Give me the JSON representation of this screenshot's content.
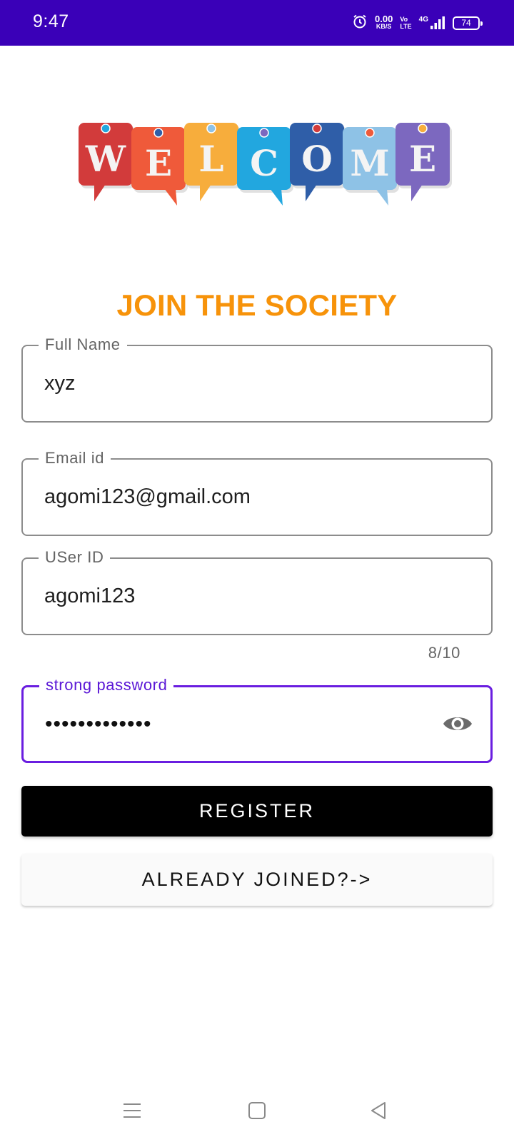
{
  "status_bar": {
    "time": "9:47",
    "net_speed_value": "0.00",
    "net_speed_unit": "KB/S",
    "volte_top": "Vo",
    "volte_bottom": "LTE",
    "network": "4G",
    "battery": "74"
  },
  "banner": {
    "letters": [
      "W",
      "E",
      "L",
      "C",
      "O",
      "M",
      "E"
    ],
    "colors": [
      "#d23b3b",
      "#ef5a3a",
      "#f7ad3c",
      "#22a7df",
      "#2f5ea8",
      "#8ec2e6",
      "#7c68bf"
    ]
  },
  "title": "JOIN THE SOCIETY",
  "fields": {
    "full_name": {
      "label": "Full Name",
      "value": "xyz"
    },
    "email": {
      "label": "Email id",
      "value": "agomi123@gmail.com"
    },
    "user_id": {
      "label": "USer ID",
      "value": "agomi123",
      "counter": "8/10"
    },
    "password": {
      "label": "strong password",
      "value": "•••••••••••••"
    }
  },
  "buttons": {
    "register": "REGISTER",
    "already_joined": "ALREADY JOINED?->"
  },
  "colors": {
    "status_bar": "#3a00b8",
    "title": "#f7930a",
    "focus": "#6a1ee0",
    "register_bg": "#000000"
  },
  "icons": {
    "status": [
      "alarm-icon",
      "volte-icon",
      "signal-icon",
      "battery-icon"
    ],
    "password_toggle": "eye-icon",
    "nav": [
      "menu-icon",
      "home-square-icon",
      "back-triangle-icon"
    ]
  }
}
